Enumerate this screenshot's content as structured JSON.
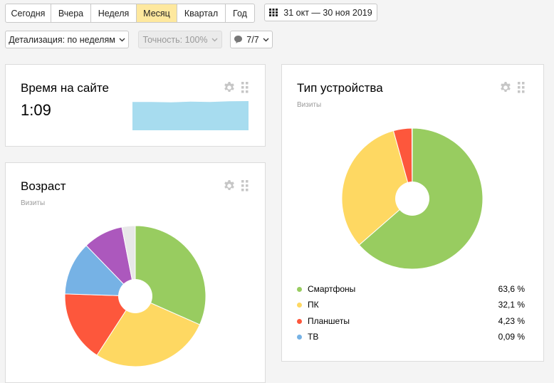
{
  "periods": [
    "Сегодня",
    "Вчера",
    "Неделя",
    "Месяц",
    "Квартал",
    "Год"
  ],
  "active_period": "Месяц",
  "date_range": "31 окт — 30 ноя 2019",
  "detail_label": "Детализация: по неделям",
  "accuracy_label": "Точность: 100%",
  "segments_label": "7/7",
  "icons": {
    "calendar": "calendar-icon",
    "chevron": "chevron-down-icon",
    "segments": "speech-bubble-icon",
    "settings": "gear-icon",
    "drag": "drag-handle-icon"
  },
  "time_widget": {
    "title": "Время на сайте",
    "value": "1:09"
  },
  "age_widget": {
    "title": "Возраст",
    "subtitle": "Визиты"
  },
  "device_widget": {
    "title": "Тип устройства",
    "subtitle": "Визиты",
    "legend": [
      {
        "label": "Смартфоны",
        "value": "63,6 %",
        "color": "#98cc60"
      },
      {
        "label": "ПК",
        "value": "32,1 %",
        "color": "#fed862"
      },
      {
        "label": "Планшеты",
        "value": "4,23 %",
        "color": "#fd573c"
      },
      {
        "label": "ТВ",
        "value": "0,09 %",
        "color": "#76b2e5"
      }
    ]
  },
  "chart_data": [
    {
      "type": "pie",
      "title": "Тип устройства",
      "subtitle": "Визиты",
      "donut": true,
      "categories": [
        "Смартфоны",
        "ПК",
        "Планшеты",
        "ТВ"
      ],
      "values": [
        63.6,
        32.1,
        4.23,
        0.09
      ],
      "colors": [
        "#98cc60",
        "#fed862",
        "#fd573c",
        "#76b2e5"
      ]
    },
    {
      "type": "pie",
      "title": "Возраст",
      "subtitle": "Визиты",
      "donut": true,
      "values": [
        31,
        27,
        16,
        12,
        9,
        3
      ],
      "colors": [
        "#98cc60",
        "#fed862",
        "#fd573c",
        "#76b2e5",
        "#ac58bd",
        "#e8e8e8"
      ]
    },
    {
      "type": "area",
      "title": "Время на сайте",
      "values": [
        1.0,
        1.0,
        0.97,
        1.02,
        1.0,
        1.05,
        1.06
      ],
      "color": "#a7dcef"
    }
  ]
}
